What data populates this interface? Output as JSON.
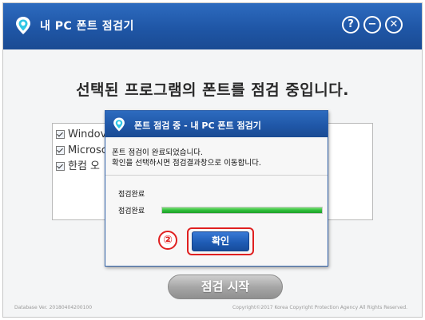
{
  "app": {
    "title": "내 PC 폰트 점검기"
  },
  "window_controls": {
    "help_label": "?",
    "minimize_label": "−",
    "close_label": "✕"
  },
  "main": {
    "headline": "선택된 프로그램의 폰트를 점검 중입니다.",
    "program_list": [
      {
        "label": "Windov",
        "checked": true
      },
      {
        "label": "Microsc",
        "checked": true
      },
      {
        "label": "한컴 오",
        "checked": true
      }
    ],
    "start_button_label": "점검 시작"
  },
  "footer": {
    "database_version": "Database Ver. 20180404200100",
    "copyright": "Copyright©2017 Korea Copyright Protection Agency All Rights Reserved."
  },
  "dialog": {
    "title": "폰트 점검 중 - 내 PC 폰트 점검기",
    "message_line1": "폰트 점검이 완료되었습니다.",
    "message_line2": "확인을 선택하시면 점검결과창으로 이동합니다.",
    "status_label_1": "점검완료",
    "status_label_2": "점검완료",
    "progress_fraction": 1.0,
    "step_number": "②",
    "confirm_label": "확인"
  },
  "colors": {
    "titlebar_blue": "#1f56a6",
    "progress_green": "#2fbf3a",
    "highlight_red": "#e02020"
  },
  "icons": {
    "app_logo": "location-pin-logo-icon",
    "help": "question-icon",
    "minimize": "minus-icon",
    "close": "close-icon"
  }
}
